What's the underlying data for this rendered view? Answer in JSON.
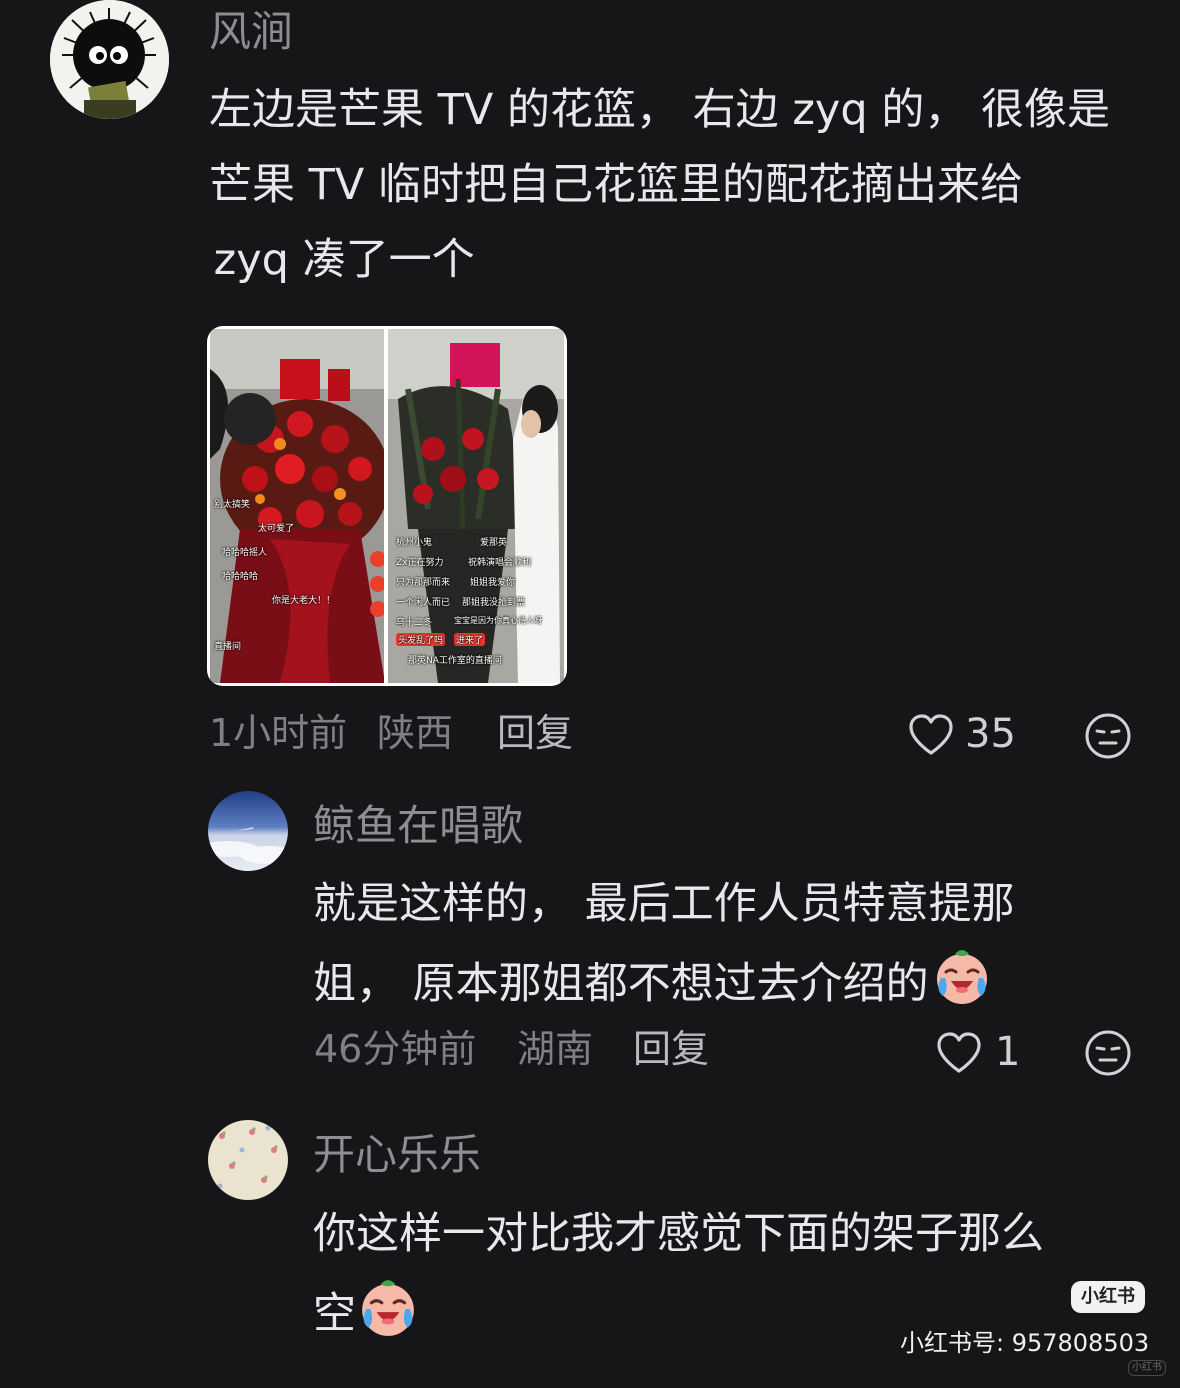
{
  "comments": [
    {
      "username": "风涧",
      "text_lines": [
        "左边是芒果 TV 的花篮， 右边 zyq 的， 很像是",
        "芒果 TV 临时把自己花篮里的配花摘出来给",
        " zyq 凑了一个"
      ],
      "time": "1小时前",
      "location": "陕西",
      "reply_label": "回复",
      "likes": "35",
      "photo_overlays": {
        "left": [
          "别太搞笑",
          "太可爱了",
          "哈哈哈摇人",
          "哈哈哈哈",
          "你是大老大！！",
          "直播间"
        ],
        "right": [
          "杭州小鬼",
          "爱那英",
          "Zx正在努力",
          "祝韩演唱会顺利",
          "只为那那而来",
          "姐姐我爱你",
          "一个闲人而已",
          "那姐我没抢到票",
          "乌十二冬",
          "宝宝是因为你真心待人呀",
          "头发乱了吗",
          "进来了",
          "那英NA工作室的直播间"
        ]
      }
    },
    {
      "username": "鲸鱼在唱歌",
      "text_lines": [
        "就是这样的， 最后工作人员特意提那",
        "姐， 原本那姐都不想过去介绍的"
      ],
      "time": "46分钟前",
      "location": "湖南",
      "reply_label": "回复",
      "likes": "1"
    },
    {
      "username": "开心乐乐",
      "text_lines": [
        "你这样一对比我才感觉下面的架子那么",
        "空"
      ],
      "time": "",
      "location": "",
      "reply_label": "",
      "likes": ""
    }
  ],
  "watermark": {
    "badge": "小红书",
    "id_text": "小红书号: 957808503",
    "corner": "小红书"
  },
  "icons": {
    "like": "heart-outline-icon",
    "dislike": "unhappy-face-icon",
    "emoji": "crying-laughing-emoji-icon"
  },
  "colors": {
    "background": "#161618",
    "username": "#8d8d92",
    "text": "#e8e8ec",
    "meta": "#7f7f85"
  }
}
